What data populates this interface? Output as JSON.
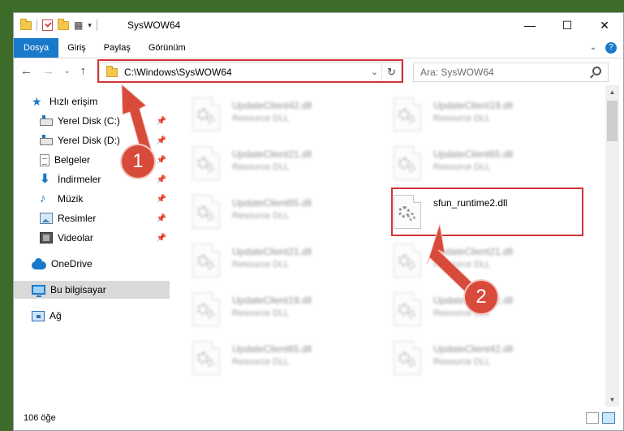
{
  "window": {
    "title": "SysWOW64",
    "controls": {
      "minimize": "—",
      "maximize": "☐",
      "close": "✕"
    }
  },
  "quick_access_toolbar": {
    "list_glyph": "▦",
    "dropdown_glyph": "▾"
  },
  "ribbon": {
    "tabs": [
      {
        "label": "Dosya",
        "active": true
      },
      {
        "label": "Giriş",
        "active": false
      },
      {
        "label": "Paylaş",
        "active": false
      },
      {
        "label": "Görünüm",
        "active": false
      }
    ],
    "expand_glyph": "⌄",
    "help_glyph": "?"
  },
  "navigation": {
    "back_glyph": "←",
    "forward_glyph": "→",
    "recent_glyph": "⌄",
    "up_glyph": "↑",
    "address": "C:\\Windows\\SysWOW64",
    "address_dropdown_glyph": "⌄",
    "refresh_glyph": "↻",
    "search_placeholder": "Ara: SysWOW64"
  },
  "sidebar": {
    "items": [
      {
        "label": "Hızlı erişim",
        "icon": "star-icon",
        "pinned": false
      },
      {
        "label": "Yerel Disk (C:)",
        "icon": "disk-icon",
        "pinned": true
      },
      {
        "label": "Yerel Disk (D:)",
        "icon": "disk-icon",
        "pinned": true
      },
      {
        "label": "Belgeler",
        "icon": "document-icon",
        "pinned": true
      },
      {
        "label": "İndirmeler",
        "icon": "download-icon",
        "pinned": true
      },
      {
        "label": "Müzik",
        "icon": "music-icon",
        "pinned": true
      },
      {
        "label": "Resimler",
        "icon": "pictures-icon",
        "pinned": true
      },
      {
        "label": "Videolar",
        "icon": "videos-icon",
        "pinned": true
      },
      {
        "label": "OneDrive",
        "icon": "onedrive-icon",
        "pinned": false
      },
      {
        "label": "Bu bilgisayar",
        "icon": "this-pc-icon",
        "pinned": false,
        "selected": true
      },
      {
        "label": "Ağ",
        "icon": "network-icon",
        "pinned": false
      }
    ],
    "pin_glyph": "📌"
  },
  "files": [
    {
      "name": "UpdateClient42.dll",
      "type": "Resource DLL",
      "blurred": true
    },
    {
      "name": "UpdateClient19.dll",
      "type": "Resource DLL",
      "blurred": true
    },
    {
      "name": "UpdateClient21.dll",
      "type": "Resource DLL",
      "blurred": true
    },
    {
      "name": "UpdateClient65.dll",
      "type": "Resource DLL",
      "blurred": true
    },
    {
      "name": "UpdateClient65.dll",
      "type": "Resource DLL",
      "blurred": true
    },
    {
      "name": "sfun_runtime2.dll",
      "type": "",
      "blurred": false
    },
    {
      "name": "UpdateClient21.dll",
      "type": "Resource DLL",
      "blurred": true
    },
    {
      "name": "UpdateClient21.dll",
      "type": "Resource DLL",
      "blurred": true
    },
    {
      "name": "UpdateClient19.dll",
      "type": "Resource DLL",
      "blurred": true
    },
    {
      "name": "UpdateClient42.dll",
      "type": "Resource DLL",
      "blurred": true
    },
    {
      "name": "UpdateClient65.dll",
      "type": "Resource DLL",
      "blurred": true
    },
    {
      "name": "UpdateClient42.dll",
      "type": "Resource DLL",
      "blurred": true
    }
  ],
  "scrollbar": {
    "up_glyph": "▲",
    "down_glyph": "▼"
  },
  "status": {
    "item_count": "106 öğe"
  },
  "annotations": {
    "badge1": "1",
    "badge2": "2",
    "highlight_color": "#d13438",
    "badge_color": "#d84a3a"
  },
  "colors": {
    "ribbon_active_tab": "#1979ca",
    "selection": "#cce8ff",
    "selected_nav": "#d9d9d9",
    "accent": "#1979ca"
  }
}
